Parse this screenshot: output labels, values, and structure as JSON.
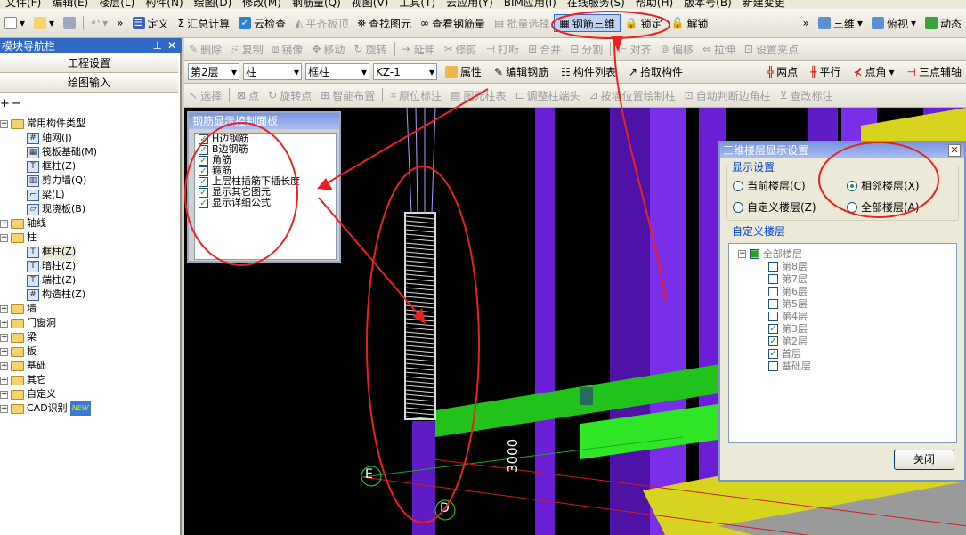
{
  "menu": [
    "文件(F)",
    "编辑(E)",
    "楼层(L)",
    "构件(N)",
    "绘图(D)",
    "修改(M)",
    "钢筋量(Q)",
    "视图(V)",
    "工具(T)",
    "云应用(Y)",
    "BIM应用(I)",
    "在线服务(S)",
    "帮助(H)",
    "版本号(B)",
    "新建变更"
  ],
  "toolbar1": {
    "define": "定义",
    "sum_calc": "汇总计算",
    "cloud_check": "云检查",
    "flatten": "平齐板顶",
    "find_element": "查找图元",
    "view_rebar": "查看钢筋量",
    "batch_select": "批量选择",
    "rebar_3d": "钢筋三维",
    "lock": "锁定",
    "unlock": "解锁",
    "view_mode": "三维",
    "view_dir": "俯视",
    "dynamic": "动态"
  },
  "toolbar2": [
    "删除",
    "复制",
    "镜像",
    "移动",
    "旋转",
    "延伸",
    "修剪",
    "打断",
    "合并",
    "分割",
    "对齐",
    "偏移",
    "拉伸",
    "设置夹点"
  ],
  "toolbar3": {
    "floor": "第2层",
    "cat": "柱",
    "type": "框柱",
    "name": "KZ-1",
    "properties": "属性",
    "edit_rebar": "编辑钢筋",
    "element_list": "构件列表",
    "pick_element": "拾取构件",
    "two_points": "两点",
    "parallel": "平行",
    "point_angle": "点角",
    "three_point_aux": "三点辅轴"
  },
  "toolbar4": [
    "选择",
    "点",
    "旋转点",
    "智能布置",
    "原位标注",
    "图元柱表",
    "调整柱端头",
    "按墙位置绘制柱",
    "自动判断边角柱",
    "查改标注"
  ],
  "nav": {
    "title": "模块导航栏",
    "btn_project": "工程设置",
    "btn_draw": "绘图输入",
    "tree": [
      {
        "label": "常用构件类型",
        "level": 0,
        "kind": "folder",
        "exp": "−"
      },
      {
        "label": "轴网(J)",
        "level": 1,
        "kind": "icon",
        "icon": "#"
      },
      {
        "label": "筏板基础(M)",
        "level": 1,
        "kind": "icon",
        "icon": "▦"
      },
      {
        "label": "框柱(Z)",
        "level": 1,
        "kind": "icon",
        "icon": "T"
      },
      {
        "label": "剪力墙(Q)",
        "level": 1,
        "kind": "icon",
        "icon": "▥"
      },
      {
        "label": "梁(L)",
        "level": 1,
        "kind": "icon",
        "icon": "⌐"
      },
      {
        "label": "现浇板(B)",
        "level": 1,
        "kind": "icon",
        "icon": "▱"
      },
      {
        "label": "轴线",
        "level": 0,
        "kind": "folder",
        "exp": "+"
      },
      {
        "label": "柱",
        "level": 0,
        "kind": "folder",
        "exp": "−"
      },
      {
        "label": "框柱(Z)",
        "level": 1,
        "kind": "icon",
        "icon": "T"
      },
      {
        "label": "暗柱(Z)",
        "level": 1,
        "kind": "icon",
        "icon": "T"
      },
      {
        "label": "端柱(Z)",
        "level": 1,
        "kind": "icon",
        "icon": "T"
      },
      {
        "label": "构造柱(Z)",
        "level": 1,
        "kind": "icon",
        "icon": "#"
      },
      {
        "label": "墙",
        "level": 0,
        "kind": "folder",
        "exp": "+"
      },
      {
        "label": "门窗洞",
        "level": 0,
        "kind": "folder",
        "exp": "+"
      },
      {
        "label": "梁",
        "level": 0,
        "kind": "folder",
        "exp": "+"
      },
      {
        "label": "板",
        "level": 0,
        "kind": "folder",
        "exp": "+"
      },
      {
        "label": "基础",
        "level": 0,
        "kind": "folder",
        "exp": "+"
      },
      {
        "label": "其它",
        "level": 0,
        "kind": "folder",
        "exp": "+"
      },
      {
        "label": "自定义",
        "level": 0,
        "kind": "folder",
        "exp": "+"
      },
      {
        "label": "CAD识别",
        "level": 0,
        "kind": "folder",
        "exp": "+"
      }
    ],
    "cad_new_badge": "NEW"
  },
  "rebar_panel": {
    "title": "钢筋显示控制面板",
    "items": [
      "H边钢筋",
      "B边钢筋",
      "角筋",
      "箍筋",
      "上层柱插筋下插长度",
      "显示其它图元",
      "显示详细公式"
    ]
  },
  "viewport": {
    "axis_e": "E",
    "axis_d": "D",
    "dimension": "3000"
  },
  "floor_dialog": {
    "title": "三维楼层显示设置",
    "display_group": "显示设置",
    "radios": [
      {
        "label": "当前楼层(C)",
        "checked": false
      },
      {
        "label": "相邻楼层(X)",
        "checked": true
      },
      {
        "label": "自定义楼层(Z)",
        "checked": false
      },
      {
        "label": "全部楼层(A)",
        "checked": false
      }
    ],
    "custom_group": "自定义楼层",
    "all_floors": "全部楼层",
    "floors": [
      {
        "label": "第8层",
        "checked": false
      },
      {
        "label": "第7层",
        "checked": false
      },
      {
        "label": "第6层",
        "checked": false
      },
      {
        "label": "第5层",
        "checked": false
      },
      {
        "label": "第4层",
        "checked": false
      },
      {
        "label": "第3层",
        "checked": true
      },
      {
        "label": "第2层",
        "checked": true
      },
      {
        "label": "首层",
        "checked": true
      },
      {
        "label": "基础层",
        "checked": false
      }
    ],
    "close_button": "关闭"
  },
  "colors": {
    "annotation_red": "#e8231f",
    "wall_purple": "#6a1fd6",
    "slab_yellow": "#d6d41f",
    "beam_green": "#21c21a",
    "title_blue": "#316ac5"
  }
}
